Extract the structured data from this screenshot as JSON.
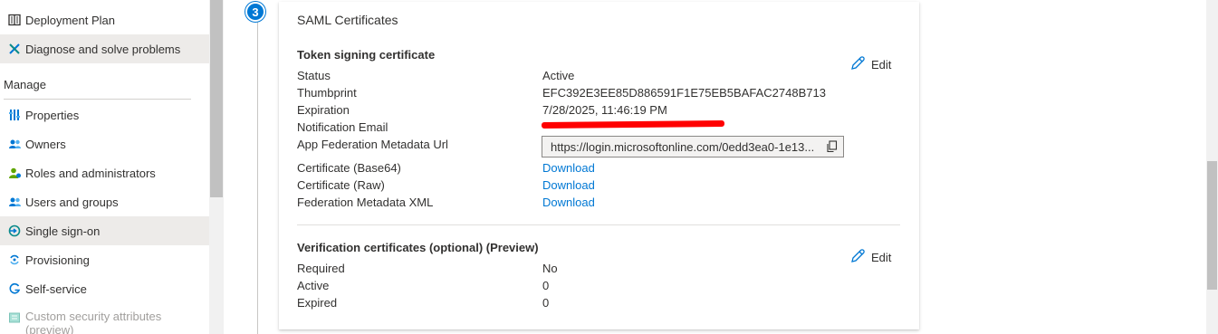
{
  "sidebar": {
    "items_top": [
      {
        "label": "Deployment Plan",
        "icon": "book-icon"
      },
      {
        "label": "Diagnose and solve problems",
        "icon": "wrench-icon"
      }
    ],
    "section_heading": "Manage",
    "items": [
      {
        "label": "Properties",
        "icon": "properties-icon"
      },
      {
        "label": "Owners",
        "icon": "owners-icon"
      },
      {
        "label": "Roles and administrators",
        "icon": "roles-icon"
      },
      {
        "label": "Users and groups",
        "icon": "users-groups-icon"
      },
      {
        "label": "Single sign-on",
        "icon": "sso-icon"
      },
      {
        "label": "Provisioning",
        "icon": "provisioning-icon"
      },
      {
        "label": "Self-service",
        "icon": "self-service-icon"
      },
      {
        "label": "Custom security attributes",
        "label2": "(preview)",
        "icon": "custom-attributes-icon"
      }
    ]
  },
  "step": {
    "number": "3"
  },
  "card": {
    "title": "SAML Certificates",
    "token": {
      "heading": "Token signing certificate",
      "edit_label": "Edit",
      "rows": {
        "status_label": "Status",
        "status_value": "Active",
        "thumbprint_label": "Thumbprint",
        "thumbprint_value": "EFC392E3EE85D886591F1E75EB5BAFAC2748B713",
        "expiration_label": "Expiration",
        "expiration_value": "7/28/2025, 11:46:19 PM",
        "email_label": "Notification Email",
        "metadata_url_label": "App Federation Metadata Url",
        "metadata_url_value": "https://login.microsoftonline.com/0edd3ea0-1e13...",
        "cert_base64_label": "Certificate (Base64)",
        "cert_base64_link": "Download",
        "cert_raw_label": "Certificate (Raw)",
        "cert_raw_link": "Download",
        "fed_xml_label": "Federation Metadata XML",
        "fed_xml_link": "Download"
      }
    },
    "verification": {
      "heading": "Verification certificates (optional) (Preview)",
      "edit_label": "Edit",
      "rows": {
        "required_label": "Required",
        "required_value": "No",
        "active_label": "Active",
        "active_value": "0",
        "expired_label": "Expired",
        "expired_value": "0"
      }
    }
  },
  "colors": {
    "accent": "#0078d4",
    "selected_bg": "#edebe9",
    "redaction": "#ff0000"
  }
}
